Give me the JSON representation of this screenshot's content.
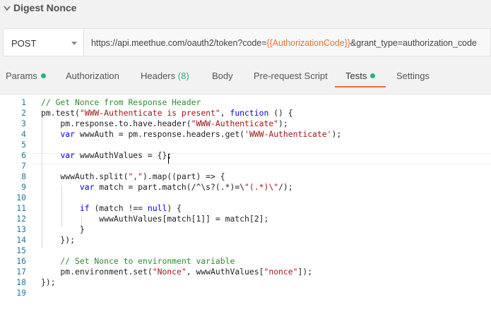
{
  "request": {
    "name": "Digest Nonce",
    "method": "POST",
    "url_prefix": "https://api.meethue.com/oauth2/token?code=",
    "url_variable": "{{AuthorizationCode}}",
    "url_suffix": "&grant_type=authorization_code"
  },
  "tabs": [
    {
      "label": "Params",
      "dot": true
    },
    {
      "label": "Authorization"
    },
    {
      "label": "Headers",
      "count": "(8)"
    },
    {
      "label": "Body"
    },
    {
      "label": "Pre-request Script"
    },
    {
      "label": "Tests",
      "dot": true,
      "active": true
    },
    {
      "label": "Settings"
    }
  ],
  "editor": {
    "lines": [
      {
        "n": "1",
        "text": "// Get Nonce from Response Header"
      },
      {
        "n": "2",
        "text": "pm.test(\"WWW-Authenticate is present\", function () {"
      },
      {
        "n": "3",
        "text": "    pm.response.to.have.header(\"WWW-Authenticate\");"
      },
      {
        "n": "4",
        "text": "    var wwwAuth = pm.response.headers.get('WWW-Authenticate');"
      },
      {
        "n": "5",
        "text": ""
      },
      {
        "n": "6",
        "text": "    var wwwAuthValues = {};"
      },
      {
        "n": "7",
        "text": ""
      },
      {
        "n": "8",
        "text": "    wwwAuth.split(\",\").map((part) => {"
      },
      {
        "n": "9",
        "text": "        var match = part.match(/^\\s?(.*)=\\\"(.*)\\\"/);"
      },
      {
        "n": "10",
        "text": ""
      },
      {
        "n": "11",
        "text": "        if (match !== null) {"
      },
      {
        "n": "12",
        "text": "            wwwAuthValues[match[1]] = match[2];"
      },
      {
        "n": "13",
        "text": "        }"
      },
      {
        "n": "14",
        "text": "    });"
      },
      {
        "n": "15",
        "text": ""
      },
      {
        "n": "16",
        "text": "    // Set Nonce to environment variable"
      },
      {
        "n": "17",
        "text": "    pm.environment.set(\"Nonce\", wwwAuthValues[\"nonce\"]);"
      },
      {
        "n": "18",
        "text": "});"
      },
      {
        "n": "19",
        "text": ""
      }
    ]
  },
  "colors": {
    "accent": "#f26b3a",
    "status_dot": "#26b47f",
    "url_variable": "#e8732b",
    "line_number": "#237893",
    "comment": "#2e8b2e",
    "string": "#a31515",
    "keyword": "#0000ff"
  },
  "icons": [
    "chevron-down-icon",
    "caret-down-icon"
  ]
}
